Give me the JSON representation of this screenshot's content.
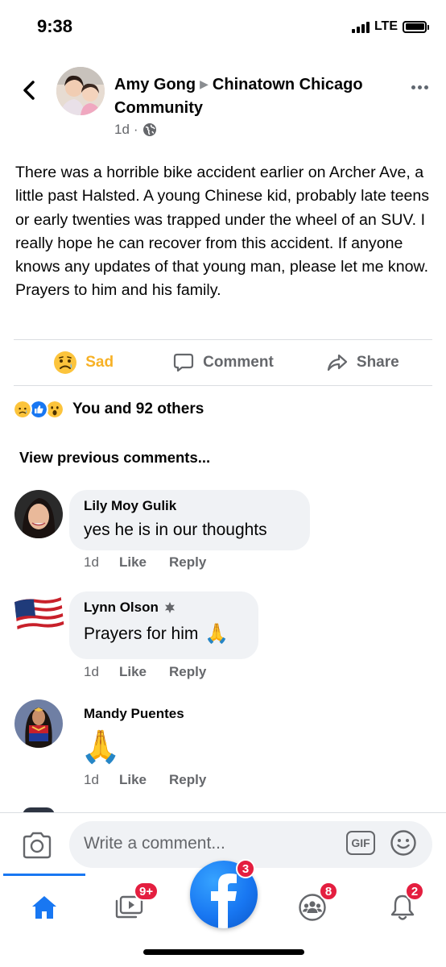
{
  "status_bar": {
    "time": "9:38",
    "network": "LTE"
  },
  "post": {
    "author": "Amy Gong",
    "group": "Chinatown Chicago Community",
    "time": "1d",
    "separator": "·",
    "text": "There was a horrible bike accident earlier on Archer Ave, a little past Halsted. A young Chinese kid, probably late teens or early twenties was trapped under the wheel of an SUV. I really hope he can recover from this accident. If anyone knows any updates of that young man, please let me know.  Prayers to him and his family."
  },
  "actions": {
    "sad": "Sad",
    "comment": "Comment",
    "share": "Share"
  },
  "reactions": {
    "summary": "You and 92 others",
    "icons": [
      "sad",
      "like",
      "wow"
    ]
  },
  "comments_section": {
    "view_previous": "View previous comments...",
    "comments": [
      {
        "name": "Lily Moy Gulik",
        "text": "yes he is in our thoughts",
        "time": "1d",
        "like": "Like",
        "reply": "Reply"
      },
      {
        "name": "Lynn Olson",
        "text": "Prayers for him",
        "emoji": "🙏",
        "time": "1d",
        "like": "Like",
        "reply": "Reply"
      },
      {
        "name": "Mandy Puentes",
        "emoji": "🙏",
        "time": "1d",
        "like": "Like",
        "reply": "Reply"
      }
    ]
  },
  "composer": {
    "placeholder": "Write a comment...",
    "gif_label": "GIF"
  },
  "tab_bar": {
    "video_badge": "9+",
    "facebook_badge": "3",
    "groups_badge": "8",
    "notifications_badge": "2"
  },
  "colors": {
    "brand_blue": "#1877f2",
    "sad_yellow": "#f7b125",
    "badge_red": "#e41e3f",
    "muted_text": "#65676b"
  }
}
